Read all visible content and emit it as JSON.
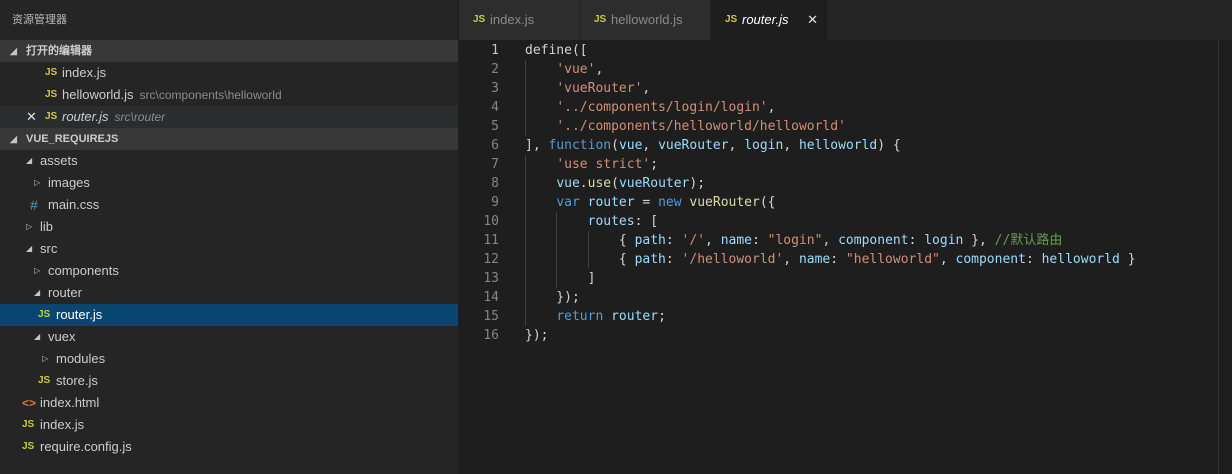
{
  "explorer": {
    "title": "资源管理器",
    "open_editors": {
      "header": "打开的编辑器",
      "items": [
        {
          "name": "index.js",
          "desc": ""
        },
        {
          "name": "helloworld.js",
          "desc": "src\\components\\helloworld"
        },
        {
          "name": "router.js",
          "desc": "src\\router"
        }
      ]
    },
    "project": {
      "header": "VUE_REQUIREJS",
      "tree": [
        {
          "name": "assets",
          "type": "folder",
          "expanded": true
        },
        {
          "name": "images",
          "type": "folder",
          "expanded": false
        },
        {
          "name": "main.css",
          "type": "css"
        },
        {
          "name": "lib",
          "type": "folder",
          "expanded": false
        },
        {
          "name": "src",
          "type": "folder",
          "expanded": true
        },
        {
          "name": "components",
          "type": "folder",
          "expanded": false
        },
        {
          "name": "router",
          "type": "folder",
          "expanded": true
        },
        {
          "name": "router.js",
          "type": "js",
          "selected": true
        },
        {
          "name": "vuex",
          "type": "folder",
          "expanded": true
        },
        {
          "name": "modules",
          "type": "folder",
          "expanded": false
        },
        {
          "name": "store.js",
          "type": "js"
        },
        {
          "name": "index.html",
          "type": "html"
        },
        {
          "name": "index.js",
          "type": "js"
        },
        {
          "name": "require.config.js",
          "type": "js"
        }
      ]
    }
  },
  "icons": {
    "js": "JS",
    "css": "#",
    "html": "<>",
    "close": "✕",
    "expanded": "◢",
    "collapsed": "▷"
  },
  "tabs": [
    {
      "label": "index.js",
      "active": false
    },
    {
      "label": "helloworld.js",
      "active": false
    },
    {
      "label": "router.js",
      "active": true
    }
  ],
  "code": {
    "current_line": 1,
    "lines": [
      [
        [
          "define([",
          "p"
        ]
      ],
      [
        [
          "    ",
          "p"
        ],
        [
          "'vue'",
          "str"
        ],
        [
          ",",
          "p"
        ]
      ],
      [
        [
          "    ",
          "p"
        ],
        [
          "'vueRouter'",
          "str"
        ],
        [
          ",",
          "p"
        ]
      ],
      [
        [
          "    ",
          "p"
        ],
        [
          "'../components/login/login'",
          "str"
        ],
        [
          ",",
          "p"
        ]
      ],
      [
        [
          "    ",
          "p"
        ],
        [
          "'../components/helloworld/helloworld'",
          "str"
        ]
      ],
      [
        [
          "], ",
          "p"
        ],
        [
          "function",
          "kw"
        ],
        [
          "(",
          "p"
        ],
        [
          "vue",
          "var"
        ],
        [
          ", ",
          "p"
        ],
        [
          "vueRouter",
          "var"
        ],
        [
          ", ",
          "p"
        ],
        [
          "login",
          "var"
        ],
        [
          ", ",
          "p"
        ],
        [
          "helloworld",
          "var"
        ],
        [
          ") {",
          "p"
        ]
      ],
      [
        [
          "    ",
          "p"
        ],
        [
          "'use strict'",
          "str"
        ],
        [
          ";",
          "p"
        ]
      ],
      [
        [
          "    ",
          "p"
        ],
        [
          "vue",
          "var"
        ],
        [
          ".",
          "p"
        ],
        [
          "use",
          "fn"
        ],
        [
          "(",
          "p"
        ],
        [
          "vueRouter",
          "var"
        ],
        [
          ");",
          "p"
        ]
      ],
      [
        [
          "    ",
          "p"
        ],
        [
          "var",
          "kw"
        ],
        [
          " ",
          "p"
        ],
        [
          "router",
          "var"
        ],
        [
          " = ",
          "p"
        ],
        [
          "new",
          "kw"
        ],
        [
          " ",
          "p"
        ],
        [
          "vueRouter",
          "fn"
        ],
        [
          "({",
          "p"
        ]
      ],
      [
        [
          "        ",
          "p"
        ],
        [
          "routes",
          "var"
        ],
        [
          ": [",
          "p"
        ]
      ],
      [
        [
          "            { ",
          "p"
        ],
        [
          "path",
          "var"
        ],
        [
          ": ",
          "p"
        ],
        [
          "'/'",
          "str"
        ],
        [
          ", ",
          "p"
        ],
        [
          "name",
          "var"
        ],
        [
          ": ",
          "p"
        ],
        [
          "\"login\"",
          "str"
        ],
        [
          ", ",
          "p"
        ],
        [
          "component",
          "var"
        ],
        [
          ": ",
          "p"
        ],
        [
          "login",
          "var"
        ],
        [
          " }, ",
          "p"
        ],
        [
          "//默认路由",
          "cm"
        ]
      ],
      [
        [
          "            { ",
          "p"
        ],
        [
          "path",
          "var"
        ],
        [
          ": ",
          "p"
        ],
        [
          "'/helloworld'",
          "str"
        ],
        [
          ", ",
          "p"
        ],
        [
          "name",
          "var"
        ],
        [
          ": ",
          "p"
        ],
        [
          "\"helloworld\"",
          "str"
        ],
        [
          ", ",
          "p"
        ],
        [
          "component",
          "var"
        ],
        [
          ": ",
          "p"
        ],
        [
          "helloworld",
          "var"
        ],
        [
          " }",
          "p"
        ]
      ],
      [
        [
          "        ]",
          "p"
        ]
      ],
      [
        [
          "    });",
          "p"
        ]
      ],
      [
        [
          "    ",
          "p"
        ],
        [
          "return",
          "kw"
        ],
        [
          " ",
          "p"
        ],
        [
          "router",
          "var"
        ],
        [
          ";",
          "p"
        ]
      ],
      [
        [
          "});",
          "p"
        ]
      ]
    ]
  }
}
